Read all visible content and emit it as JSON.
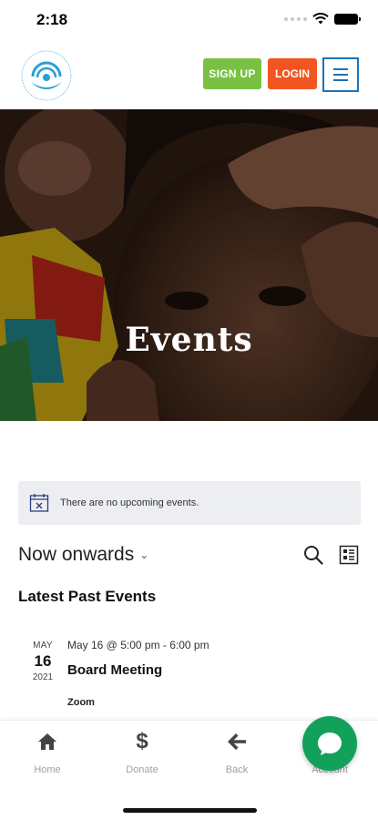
{
  "status_bar": {
    "time": "2:18"
  },
  "header": {
    "logo_icon": "breeze-of-joy-logo",
    "signup_label": "SIGN UP",
    "login_label": "LOGIN",
    "menu_icon": "hamburger-menu-icon",
    "colors": {
      "signup": "#79c143",
      "login": "#f2551f",
      "menu": "#1a73b8"
    }
  },
  "hero": {
    "title": "Events"
  },
  "notice": {
    "text": "There are no upcoming events.",
    "icon": "calendar-x-icon"
  },
  "filter": {
    "label": "Now onwards",
    "search_icon": "search-icon",
    "view_icon": "list-view-icon"
  },
  "past_events": {
    "heading": "Latest Past Events",
    "items": [
      {
        "month": "MAY",
        "day": "16",
        "year": "2021",
        "time": "May 16 @ 5:00 pm - 6:00 pm",
        "title": "Board Meeting",
        "venue": "Zoom"
      }
    ]
  },
  "bottom_nav": {
    "items": [
      {
        "label": "Home",
        "icon": "home-icon"
      },
      {
        "label": "Donate",
        "icon": "dollar-icon"
      },
      {
        "label": "Back",
        "icon": "back-arrow-icon"
      },
      {
        "label": "Account",
        "icon": "account-icon"
      }
    ]
  },
  "chat": {
    "icon": "chat-bubble-icon",
    "color": "#13a05b"
  }
}
